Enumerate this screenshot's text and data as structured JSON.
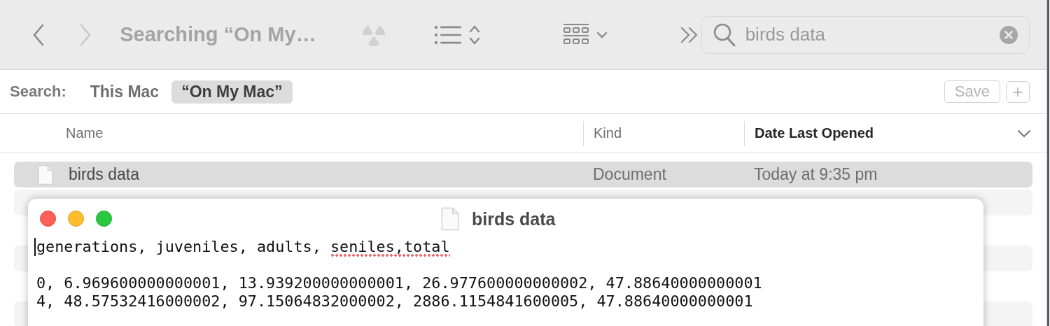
{
  "toolbar": {
    "title": "Searching “On My…",
    "back_disabled": false,
    "forward_disabled": true,
    "search": {
      "value": "birds data"
    }
  },
  "scope_bar": {
    "label": "Search:",
    "scopes": [
      {
        "label": "This Mac",
        "selected": false
      },
      {
        "label": "“On My Mac”",
        "selected": true
      }
    ],
    "save_button": "Save",
    "add_button": "+"
  },
  "table": {
    "columns": [
      {
        "label": "Name",
        "sorted": false
      },
      {
        "label": "Kind",
        "sorted": false
      },
      {
        "label": "Date Last Opened",
        "sorted": true
      }
    ],
    "rows": [
      {
        "name": "birds data",
        "kind": "Document",
        "date": "Today at 9:35 pm",
        "selected": true
      }
    ]
  },
  "editor": {
    "title": "birds data",
    "lines": [
      {
        "segments": [
          {
            "text": "generations, juveniles, adults, ",
            "misspelled": false
          },
          {
            "text": "seniles,total",
            "misspelled": true
          }
        ]
      },
      {
        "segments": [
          {
            "text": "0, 6.969600000000001, 13.939200000000001, 26.977600000000002, 47.88640000000001",
            "misspelled": false
          }
        ]
      },
      {
        "segments": [
          {
            "text": "4, 48.57532416000002, 97.15064832000002, 2886.1154841600005, 47.88640000000001",
            "misspelled": false
          }
        ]
      }
    ]
  }
}
